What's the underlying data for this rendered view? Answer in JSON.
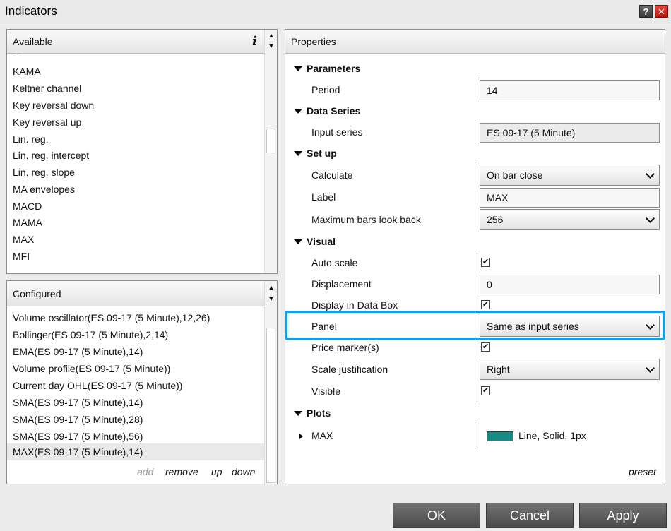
{
  "window": {
    "title": "Indicators",
    "help_label": "?",
    "close_label": "✕"
  },
  "available": {
    "header": "Available",
    "info_label": "i",
    "items": [
      "KAMA",
      "Keltner channel",
      "Key reversal down",
      "Key reversal up",
      "Lin. reg.",
      "Lin. reg. intercept",
      "Lin. reg. slope",
      "MA envelopes",
      "MACD",
      "MAMA",
      "MAX",
      "MFI"
    ]
  },
  "configured": {
    "header": "Configured",
    "items": [
      "Volume oscillator(ES 09-17 (5 Minute),12,26)",
      "Bollinger(ES 09-17 (5 Minute),2,14)",
      "EMA(ES 09-17 (5 Minute),14)",
      "Volume profile(ES 09-17 (5 Minute))",
      "Current day OHL(ES 09-17 (5 Minute))",
      "SMA(ES 09-17 (5 Minute),14)",
      "SMA(ES 09-17 (5 Minute),28)",
      "SMA(ES 09-17 (5 Minute),56)",
      "MAX(ES 09-17 (5 Minute),14)"
    ],
    "selected_index": 8,
    "actions": {
      "add": "add",
      "remove": "remove",
      "up": "up",
      "down": "down"
    }
  },
  "properties": {
    "header": "Properties",
    "sections": {
      "parameters": "Parameters",
      "data_series": "Data Series",
      "set_up": "Set up",
      "visual": "Visual",
      "plots": "Plots"
    },
    "period": {
      "label": "Period",
      "value": "14"
    },
    "input_series": {
      "label": "Input series",
      "value": "ES 09-17 (5 Minute)"
    },
    "calculate": {
      "label": "Calculate",
      "value": "On bar close"
    },
    "label_field": {
      "label": "Label",
      "value": "MAX"
    },
    "max_bars": {
      "label": "Maximum bars look back",
      "value": "256"
    },
    "auto_scale": {
      "label": "Auto scale",
      "checked": true
    },
    "displacement": {
      "label": "Displacement",
      "value": "0"
    },
    "display_in_data_box": {
      "label": "Display in Data Box",
      "checked": true
    },
    "panel": {
      "label": "Panel",
      "value": "Same as input series"
    },
    "price_markers": {
      "label": "Price marker(s)",
      "checked": true
    },
    "scale_justification": {
      "label": "Scale justification",
      "value": "Right"
    },
    "visible": {
      "label": "Visible",
      "checked": true
    },
    "plot_max": {
      "label": "MAX",
      "value": "Line, Solid, 1px",
      "color": "#178a83"
    },
    "preset_label": "preset",
    "check_mark": "✔"
  },
  "buttons": {
    "ok": "OK",
    "cancel": "Cancel",
    "apply": "Apply"
  },
  "colors": {
    "highlight": "#1a9ee0",
    "button": "#5a5a5a"
  }
}
